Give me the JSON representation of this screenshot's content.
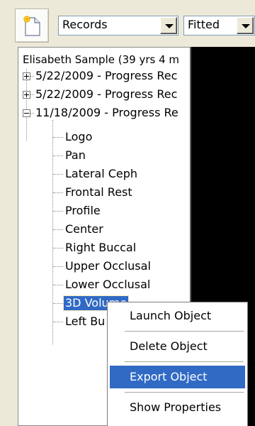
{
  "toolbar": {
    "new_icon": "new-document-icon",
    "records_value": "Records",
    "zoom_value": "Fitted"
  },
  "tree": {
    "root_label": "Elisabeth  Sample (39 yrs 4 m",
    "visits": [
      {
        "label": "5/22/2009 - Progress Rec",
        "expanded": false
      },
      {
        "label": "5/22/2009 - Progress Rec",
        "expanded": false
      },
      {
        "label": "11/18/2009 - Progress Re",
        "expanded": true
      }
    ],
    "children": [
      "Logo",
      "Pan",
      "Lateral Ceph",
      "Frontal Rest",
      "Profile",
      "Center",
      "Right Buccal",
      "Upper Occlusal",
      "Lower Occlusal",
      "3D Volume",
      "Left Bu"
    ],
    "selected_child": "3D Volume"
  },
  "context_menu": {
    "items": [
      {
        "label": "Launch Object",
        "highlighted": false
      },
      {
        "label": "Delete Object",
        "highlighted": false
      },
      {
        "label": "Export Object",
        "highlighted": true
      },
      {
        "label": "Show Properties",
        "highlighted": false
      }
    ]
  },
  "colors": {
    "selection": "#316ac5",
    "chrome": "#ece9d8",
    "viewer_bg": "#000000"
  }
}
